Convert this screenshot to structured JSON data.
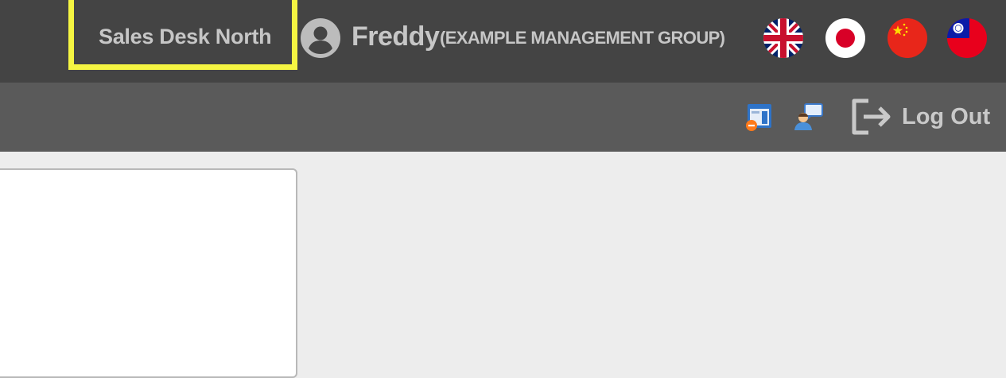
{
  "header": {
    "desk_name": "Sales Desk North",
    "user_name": "Freddy",
    "organization": "(EXAMPLE MANAGEMENT GROUP)",
    "languages": [
      {
        "name": "English",
        "icon": "uk-flag-icon"
      },
      {
        "name": "Japanese",
        "icon": "japan-flag-icon"
      },
      {
        "name": "Chinese",
        "icon": "china-flag-icon"
      },
      {
        "name": "Traditional Chinese",
        "icon": "taiwan-flag-icon"
      }
    ],
    "highlight_color": "#f5f542"
  },
  "toolbar": {
    "icons": [
      "report-icon",
      "chat-support-icon"
    ],
    "logout_label": "Log Out"
  },
  "colors": {
    "topbar": "#444444",
    "subbar": "#5a5a5a",
    "content_bg": "#ededed"
  }
}
